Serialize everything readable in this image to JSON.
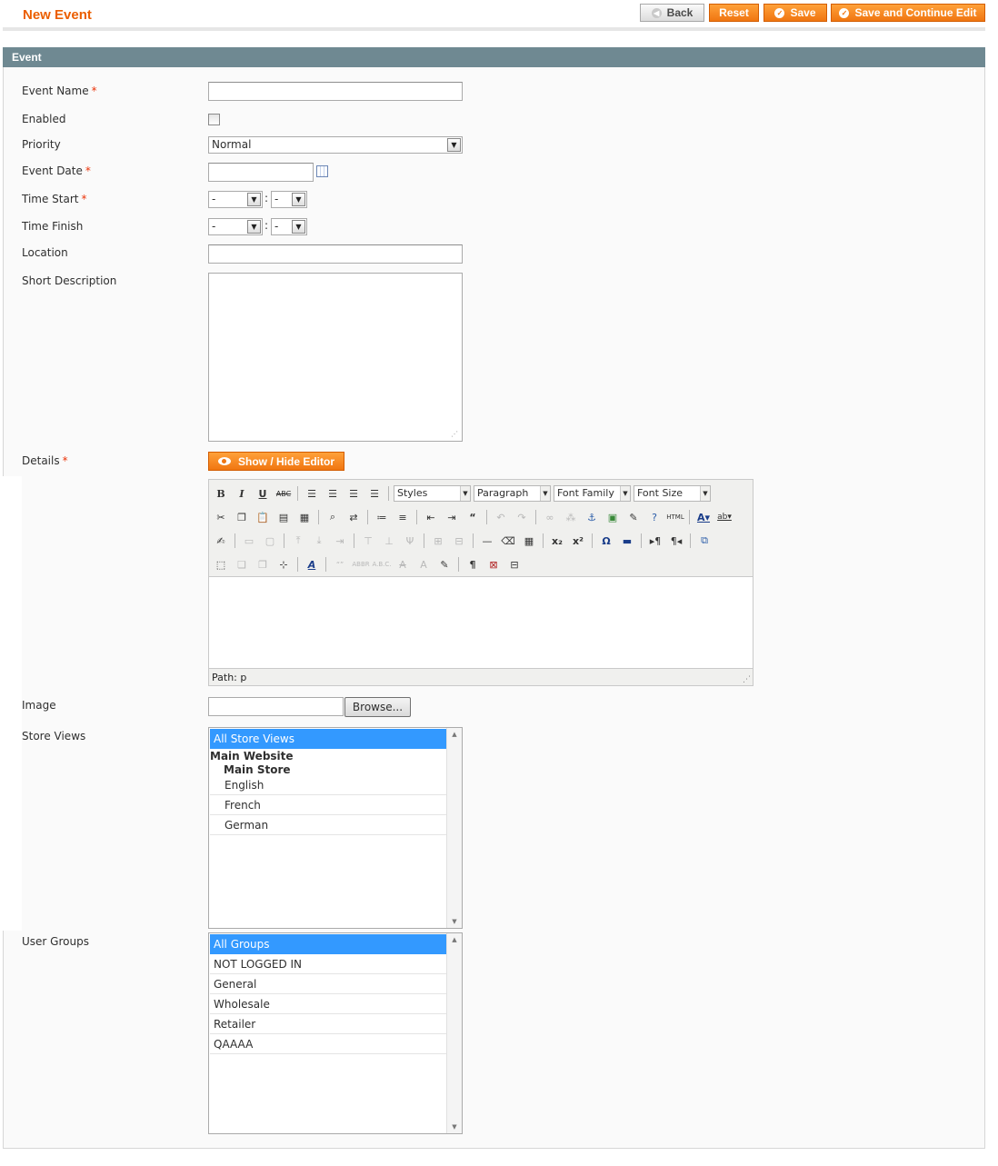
{
  "header": {
    "title": "New Event",
    "back_label": "Back",
    "reset_label": "Reset",
    "save_label": "Save",
    "save_continue_label": "Save and Continue Edit"
  },
  "fieldset": {
    "title": "Event"
  },
  "form": {
    "event_name": {
      "label": "Event Name",
      "required": "*"
    },
    "enabled": {
      "label": "Enabled"
    },
    "priority": {
      "label": "Priority",
      "value": "Normal"
    },
    "event_date": {
      "label": "Event Date",
      "required": "*"
    },
    "time_start": {
      "label": "Time Start",
      "required": "*",
      "hour": "-",
      "minute": "-",
      "sep": ":"
    },
    "time_finish": {
      "label": "Time Finish",
      "hour": "-",
      "minute": "-",
      "sep": ":"
    },
    "location": {
      "label": "Location"
    },
    "short_description": {
      "label": "Short Description"
    },
    "details": {
      "label": "Details",
      "required": "*",
      "toggle_label": "Show / Hide Editor"
    },
    "image": {
      "label": "Image",
      "browse_label": "Browse..."
    },
    "store_views": {
      "label": "Store Views",
      "all": "All Store Views",
      "website": "Main Website",
      "store": "Main Store",
      "views": [
        "English",
        "French",
        "German"
      ]
    },
    "user_groups": {
      "label": "User Groups",
      "options": [
        "All Groups",
        "NOT LOGGED IN",
        "General",
        "Wholesale",
        "Retailer",
        "QAAAA"
      ]
    }
  },
  "editor": {
    "styles": "Styles",
    "paragraph": "Paragraph",
    "font_family": "Font Family",
    "font_size": "Font Size",
    "path": "Path: p"
  }
}
